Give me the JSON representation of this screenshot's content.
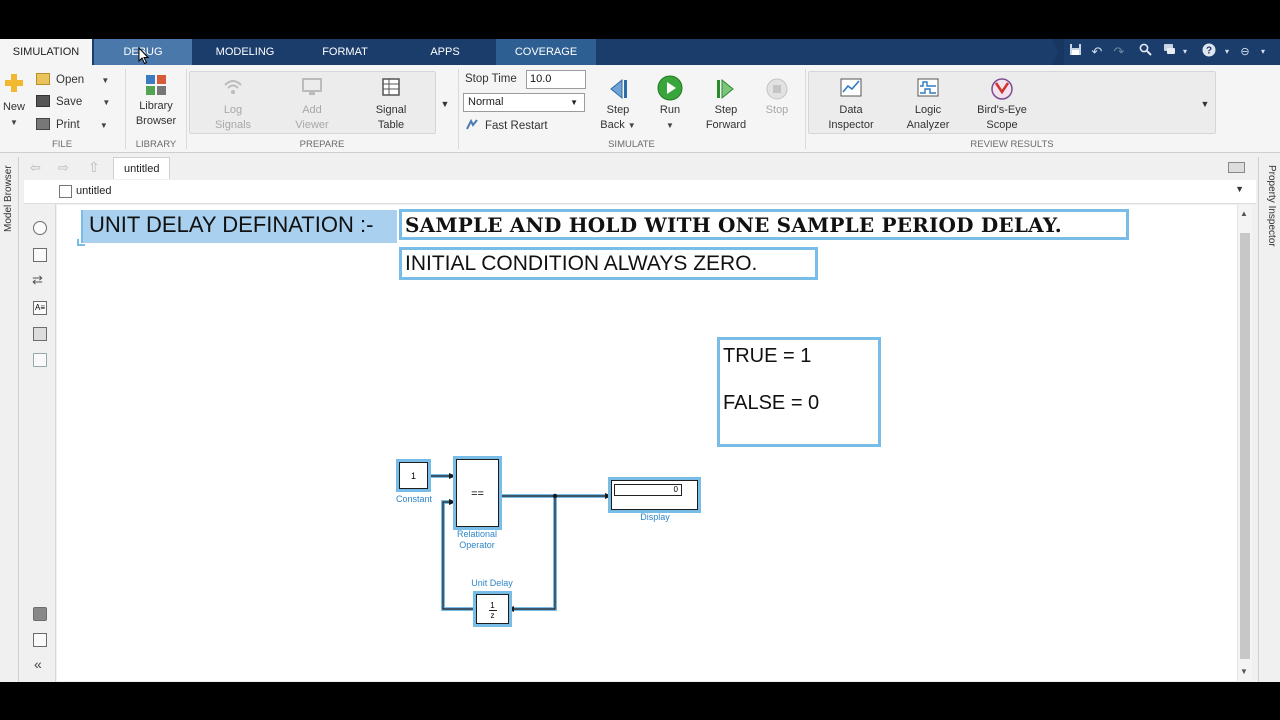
{
  "tabs": {
    "simulation": "SIMULATION",
    "debug": "DEBUG",
    "modeling": "MODELING",
    "format": "FORMAT",
    "apps": "APPS",
    "coverage": "COVERAGE"
  },
  "file": {
    "new": "New",
    "open": "Open",
    "save": "Save",
    "print": "Print",
    "label": "FILE"
  },
  "library": {
    "browser_line1": "Library",
    "browser_line2": "Browser",
    "label": "LIBRARY"
  },
  "prepare": {
    "log_line1": "Log",
    "log_line2": "Signals",
    "viewer_line1": "Add",
    "viewer_line2": "Viewer",
    "table_line1": "Signal",
    "table_line2": "Table",
    "label": "PREPARE"
  },
  "simulate": {
    "stop_time_label": "Stop Time",
    "stop_time_value": "10.0",
    "mode": "Normal",
    "fast_restart": "Fast Restart",
    "step_back_line1": "Step",
    "step_back_line2": "Back",
    "run": "Run",
    "step_forward_line1": "Step",
    "step_forward_line2": "Forward",
    "stop": "Stop",
    "label": "SIMULATE"
  },
  "review": {
    "data_line1": "Data",
    "data_line2": "Inspector",
    "logic_line1": "Logic",
    "logic_line2": "Analyzer",
    "birds_line1": "Bird's-Eye",
    "birds_line2": "Scope",
    "label": "REVIEW RESULTS"
  },
  "explorer": {
    "model_tab": "untitled",
    "address": "untitled"
  },
  "side": {
    "model_browser": "Model Browser",
    "property_inspector": "Property Inspector"
  },
  "annotations": {
    "heading": "UNIT DELAY DEFINATION :-",
    "definition": "SAMPLE AND HOLD WITH ONE SAMPLE PERIOD DELAY.",
    "initial": "INITIAL CONDITION ALWAYS ZERO.",
    "true_text": "TRUE = 1",
    "false_text": "FALSE = 0"
  },
  "blocks": {
    "constant_value": "1",
    "constant_label": "Constant",
    "relational_symbol": "==",
    "relational_label_line1": "Relational",
    "relational_label_line2": "Operator",
    "display_value": "0",
    "display_label": "Display",
    "delay_num": "1",
    "delay_den": "z",
    "delay_label": "Unit Delay"
  },
  "colors": {
    "tab_bar": "#1a3d6c",
    "selection": "#78bde8",
    "block_label": "#2e86c9",
    "heading_highlight": "#a9d1ef"
  }
}
